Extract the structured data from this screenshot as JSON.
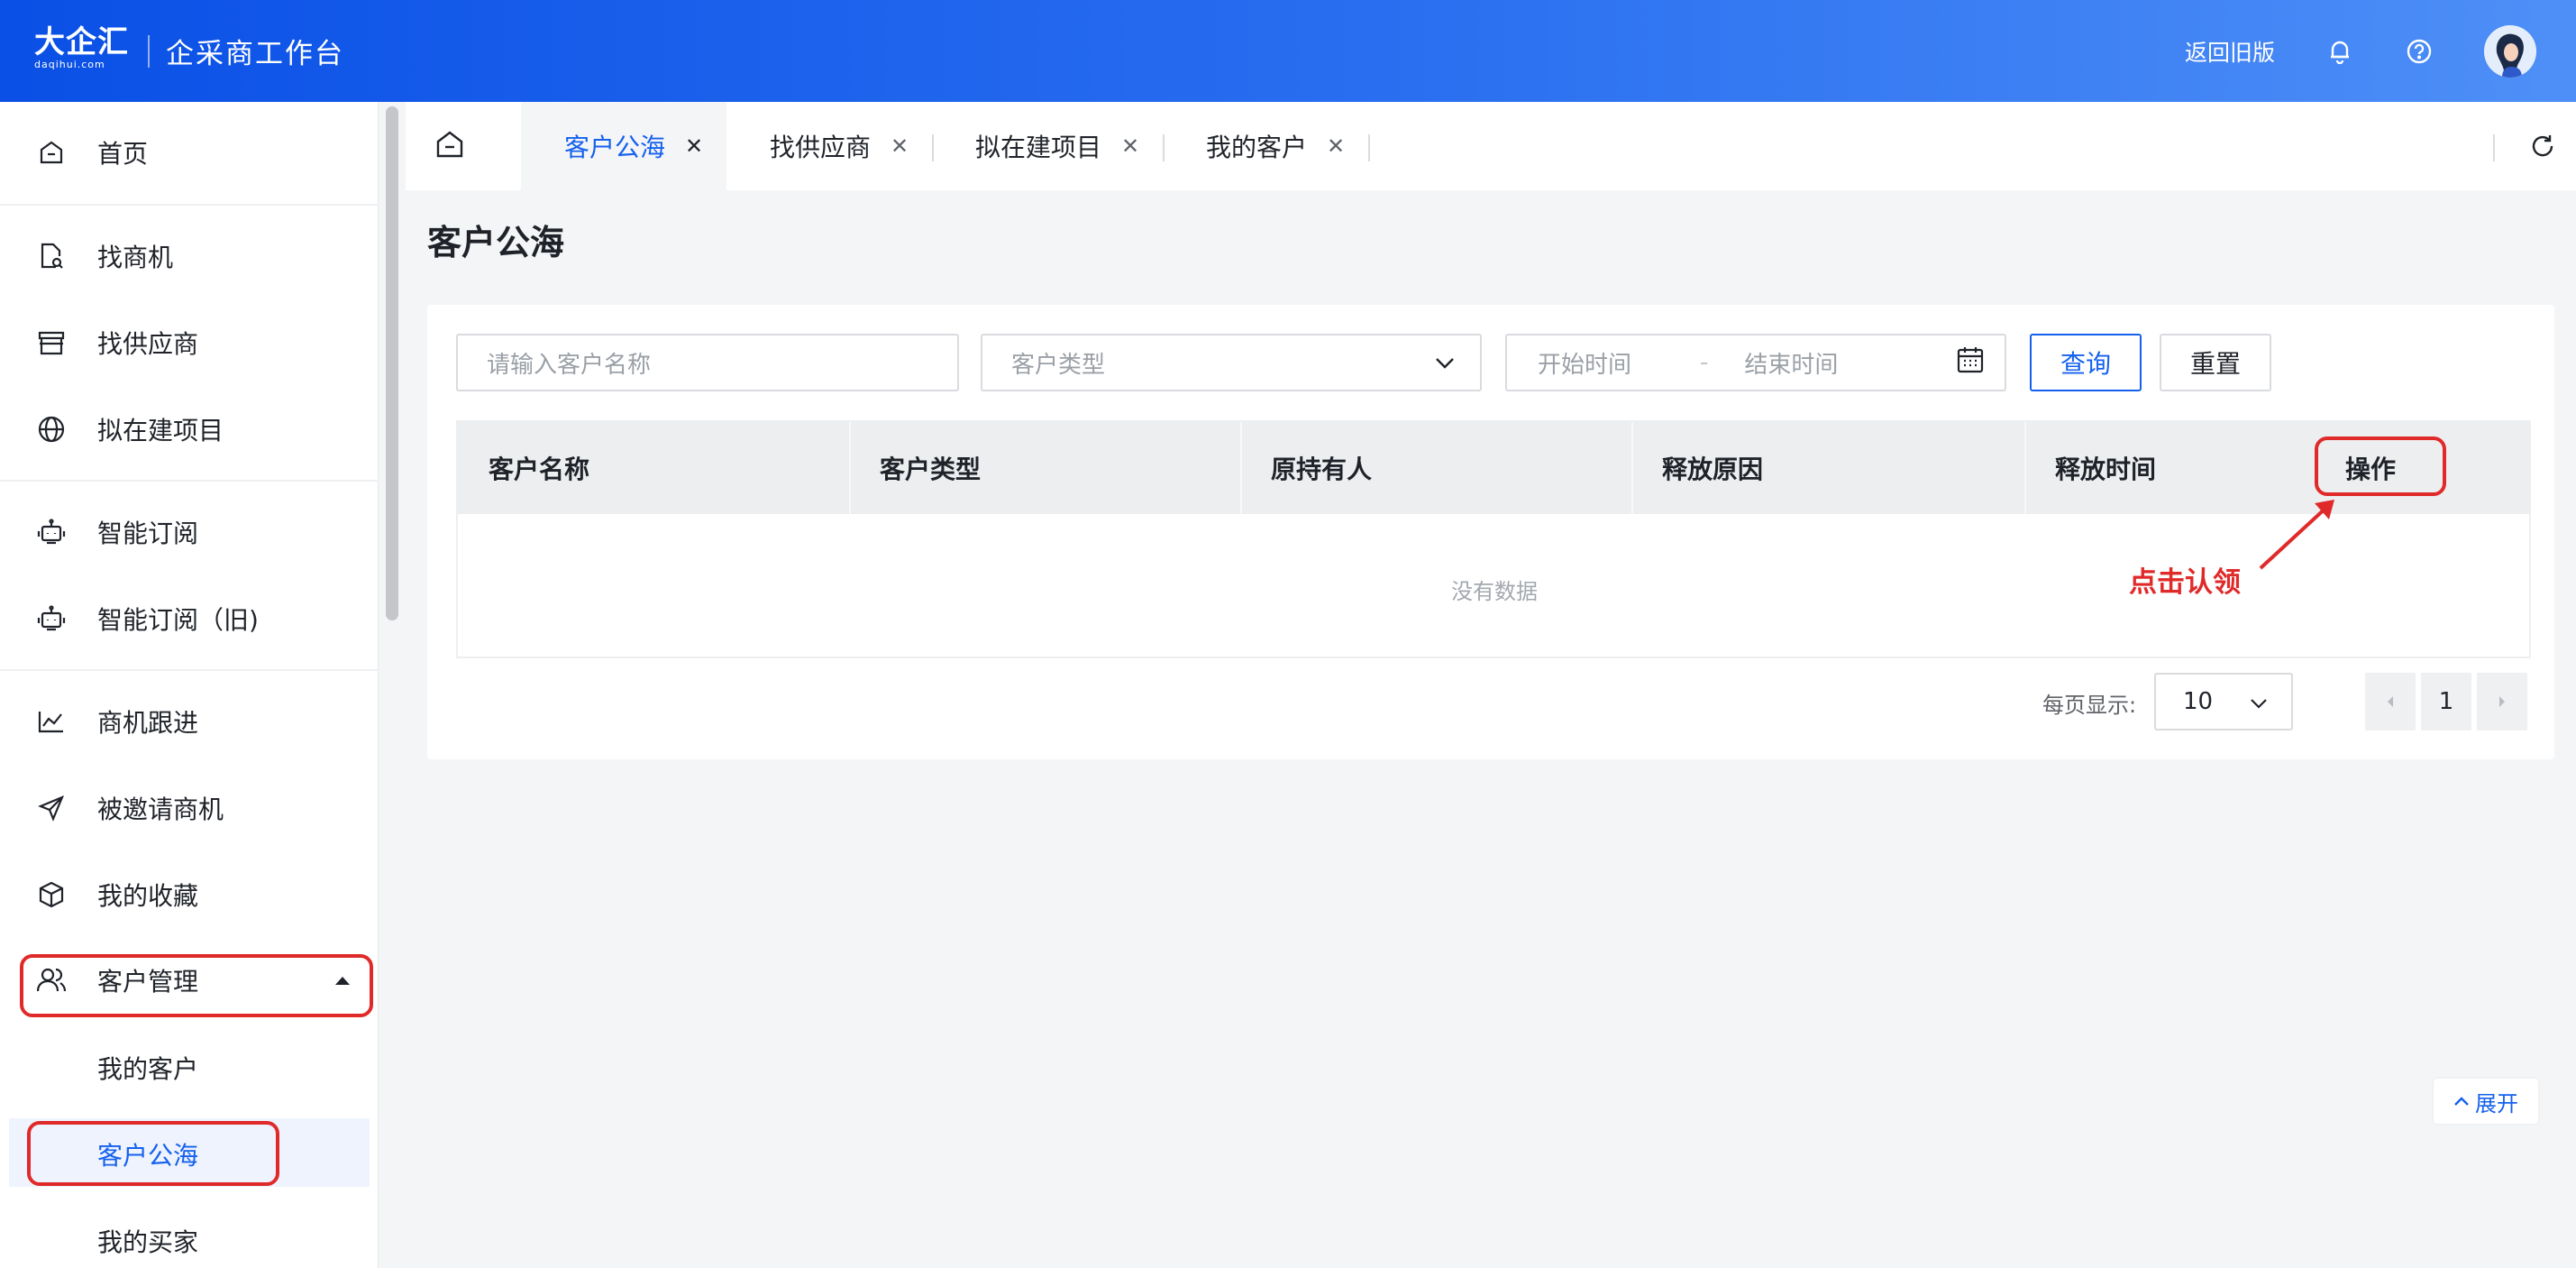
{
  "header": {
    "logo_text": "大企汇",
    "logo_sub": "daqihui.com",
    "title": "企采商工作台",
    "back_to_old": "返回旧版",
    "icons": [
      "bell-icon",
      "help-icon",
      "avatar"
    ]
  },
  "sidebar": {
    "items": [
      {
        "label": "首页",
        "icon": "home-icon"
      },
      {
        "label": "找商机",
        "icon": "document-search-icon"
      },
      {
        "label": "找供应商",
        "icon": "store-icon"
      },
      {
        "label": "拟在建项目",
        "icon": "globe-icon"
      },
      {
        "label": "智能订阅",
        "icon": "robot-icon"
      },
      {
        "label": "智能订阅（旧)",
        "icon": "robot-icon"
      },
      {
        "label": "商机跟进",
        "icon": "chart-icon"
      },
      {
        "label": "被邀请商机",
        "icon": "send-icon"
      },
      {
        "label": "我的收藏",
        "icon": "box-icon"
      },
      {
        "label": "客户管理",
        "icon": "users-icon",
        "expanded": true
      }
    ],
    "sub_items": [
      {
        "label": "我的客户"
      },
      {
        "label": "客户公海",
        "active": true
      },
      {
        "label": "我的买家"
      }
    ]
  },
  "tabs": [
    {
      "label": "客户公海",
      "active": true
    },
    {
      "label": "找供应商"
    },
    {
      "label": "拟在建项目"
    },
    {
      "label": "我的客户"
    }
  ],
  "page": {
    "title": "客户公海"
  },
  "filters": {
    "name_placeholder": "请输入客户名称",
    "type_placeholder": "客户类型",
    "start_placeholder": "开始时间",
    "range_sep": "-",
    "end_placeholder": "结束时间",
    "query_label": "查询",
    "reset_label": "重置"
  },
  "table": {
    "columns": [
      "客户名称",
      "客户类型",
      "原持有人",
      "释放原因",
      "释放时间",
      "操作"
    ],
    "rows": [],
    "empty_text": "没有数据"
  },
  "annotation": {
    "text": "点击认领",
    "color": "#e02a2a"
  },
  "pagination": {
    "page_size_label": "每页显示:",
    "page_size": "10",
    "current_page": "1"
  },
  "expand_label": "展开",
  "colors": {
    "primary": "#1561ee",
    "header_gradient_start": "#0a50e6",
    "header_gradient_end": "#4e8ff7",
    "highlight": "#e02a2a"
  }
}
